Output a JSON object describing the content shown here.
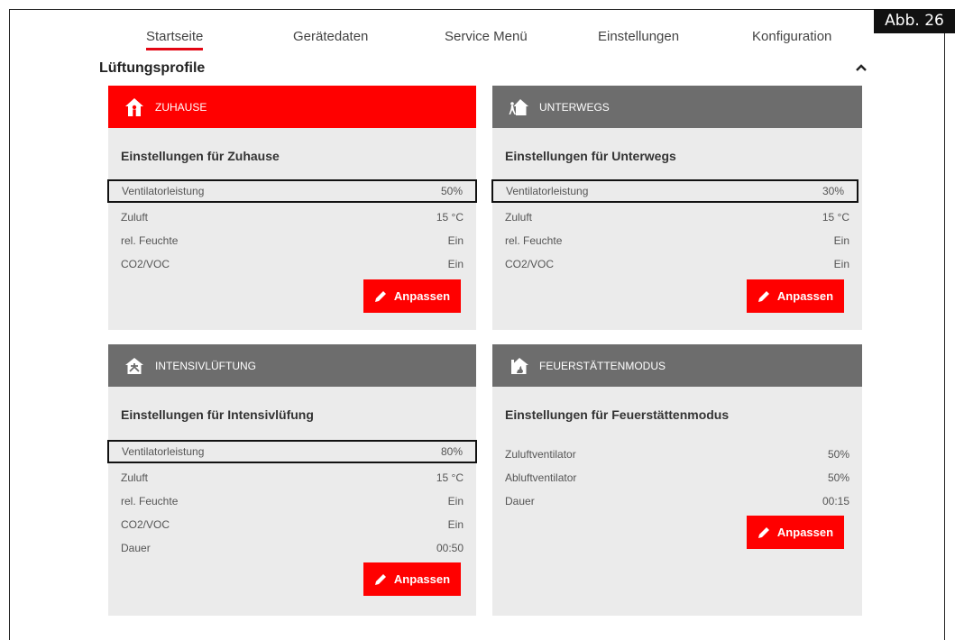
{
  "figure_label": "Abb. 26",
  "nav": {
    "items": [
      {
        "label": "Startseite",
        "active": true
      },
      {
        "label": "Gerätedaten",
        "active": false
      },
      {
        "label": "Service Menü",
        "active": false
      },
      {
        "label": "Einstellungen",
        "active": false
      },
      {
        "label": "Konfiguration",
        "active": false
      }
    ]
  },
  "section": {
    "title": "Lüftungsprofile",
    "collapse_icon": "chevron-up-icon"
  },
  "colors": {
    "accent": "#ff0000",
    "inactive_header": "#6d6d6d",
    "card_bg": "#ebebeb"
  },
  "cards": {
    "zuhause": {
      "header": "ZUHAUSE",
      "icon": "home-person-icon",
      "active": true,
      "subtitle": "Einstellungen für Zuhause",
      "rows": [
        {
          "label": "Ventilatorleistung",
          "value": "50%"
        },
        {
          "label": "Zuluft",
          "value": "15 °C"
        },
        {
          "label": "rel. Feuchte",
          "value": "Ein"
        },
        {
          "label": "CO2/VOC",
          "value": "Ein"
        }
      ],
      "button": "Anpassen"
    },
    "unterwegs": {
      "header": "UNTERWEGS",
      "icon": "away-home-icon",
      "active": false,
      "subtitle": "Einstellungen für Unterwegs",
      "rows": [
        {
          "label": "Ventilatorleistung",
          "value": "30%"
        },
        {
          "label": "Zuluft",
          "value": "15 °C"
        },
        {
          "label": "rel. Feuchte",
          "value": "Ein"
        },
        {
          "label": "CO2/VOC",
          "value": "Ein"
        }
      ],
      "button": "Anpassen"
    },
    "intensiv": {
      "header": "INTENSIVLÜFTUNG",
      "icon": "intensive-ventilation-icon",
      "active": false,
      "subtitle": "Einstellungen für Intensivlüfung",
      "rows": [
        {
          "label": "Ventilatorleistung",
          "value": "80%"
        },
        {
          "label": "Zuluft",
          "value": "15 °C"
        },
        {
          "label": "rel. Feuchte",
          "value": "Ein"
        },
        {
          "label": "CO2/VOC",
          "value": "Ein"
        },
        {
          "label": "Dauer",
          "value": "00:50"
        }
      ],
      "button": "Anpassen"
    },
    "feuer": {
      "header": "FEUERSTÄTTENMODUS",
      "icon": "fireplace-home-icon",
      "active": false,
      "subtitle": "Einstellungen für Feuerstättenmodus",
      "rows": [
        {
          "label": "Zuluftventilator",
          "value": "50%"
        },
        {
          "label": "Abluftventilator",
          "value": "50%"
        },
        {
          "label": "Dauer",
          "value": "00:15"
        }
      ],
      "button": "Anpassen"
    }
  }
}
